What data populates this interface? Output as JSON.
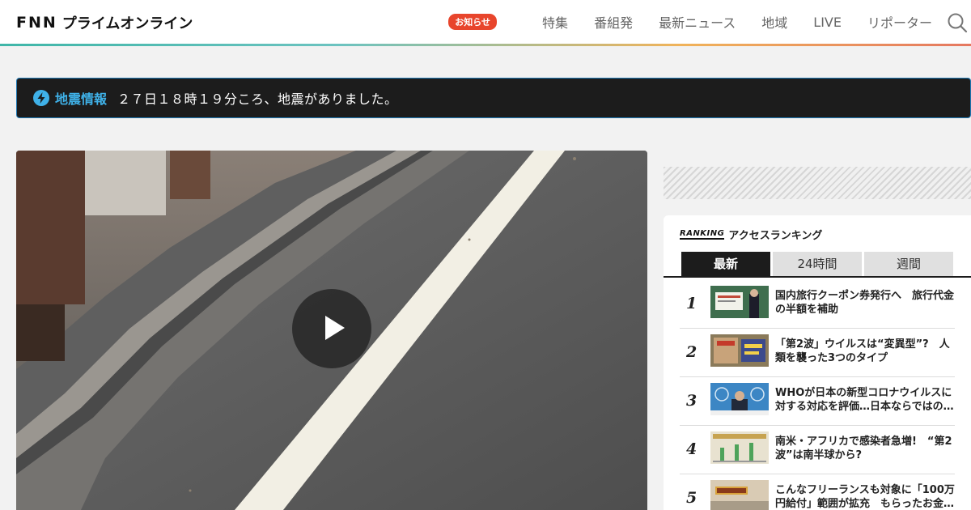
{
  "header": {
    "logo_letters": "FNN",
    "logo_text": "プライムオンライン",
    "notice_badge": "お知らせ",
    "nav": [
      "特集",
      "番組発",
      "最新ニュース",
      "地域",
      "LIVE",
      "リポーター"
    ],
    "icons": [
      "search-icon"
    ]
  },
  "alert": {
    "icon": "lightning-icon",
    "label": "地震情報",
    "text": "２７日１８時１９分ころ、地震がありました。"
  },
  "video": {
    "icon": "play-icon"
  },
  "ranking": {
    "label_en": "RANKING",
    "title": "アクセスランキング",
    "tabs": [
      {
        "label": "最新",
        "active": true
      },
      {
        "label": "24時間",
        "active": false
      },
      {
        "label": "週間",
        "active": false
      }
    ],
    "items": [
      {
        "rank": "1",
        "title": "国内旅行クーポン券発行へ　旅行代金の半額を補助"
      },
      {
        "rank": "2",
        "title": "「第2波」ウイルスは“変異型”?　人類を襲った3つのタイプ"
      },
      {
        "rank": "3",
        "title": "WHOが日本の新型コロナウイルスに対する対応を評価…日本ならではの…"
      },
      {
        "rank": "4",
        "title": "南米・アフリカで感染者急増!　“第2波”は南半球から?"
      },
      {
        "rank": "5",
        "title": "こんなフリーランスも対象に「100万円給付」範囲が拡充　もらったお金…"
      }
    ]
  },
  "colors": {
    "notice_badge": "#e8452c",
    "alert_label": "#3fb1e8",
    "alert_bg": "#1c1c1c",
    "tab_active": "#1c1c1c"
  }
}
